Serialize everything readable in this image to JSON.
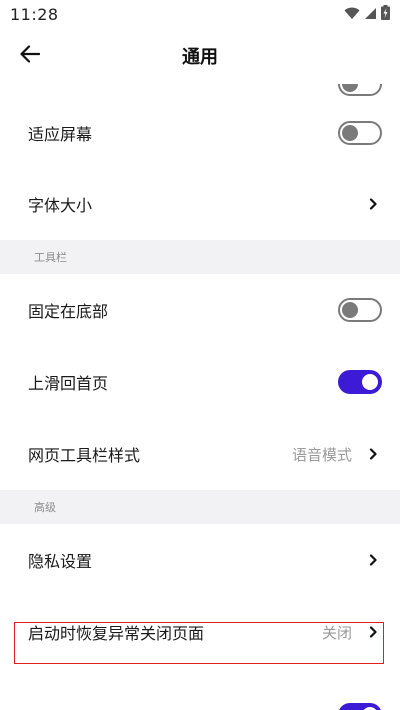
{
  "status_bar": {
    "time": "11:28"
  },
  "app_bar": {
    "title": "通用"
  },
  "rows_top": {
    "fit_screen": {
      "label": "适应屏幕",
      "toggle": "off"
    },
    "font_size": {
      "label": "字体大小"
    }
  },
  "section_toolbar": {
    "header": "工具栏",
    "pin_bottom": {
      "label": "固定在底部",
      "toggle": "off"
    },
    "swipe_home": {
      "label": "上滑回首页",
      "toggle": "on"
    },
    "toolbar_style": {
      "label": "网页工具栏样式",
      "value": "语音模式"
    }
  },
  "section_advanced": {
    "header": "高级",
    "privacy": {
      "label": "隐私设置"
    },
    "restore_pages": {
      "label": "启动时恢复异常关闭页面",
      "value": "关闭"
    }
  },
  "colors": {
    "accent": "#3d1bd6",
    "highlight": "#e02020",
    "section_bg": "#f2f2f4"
  }
}
